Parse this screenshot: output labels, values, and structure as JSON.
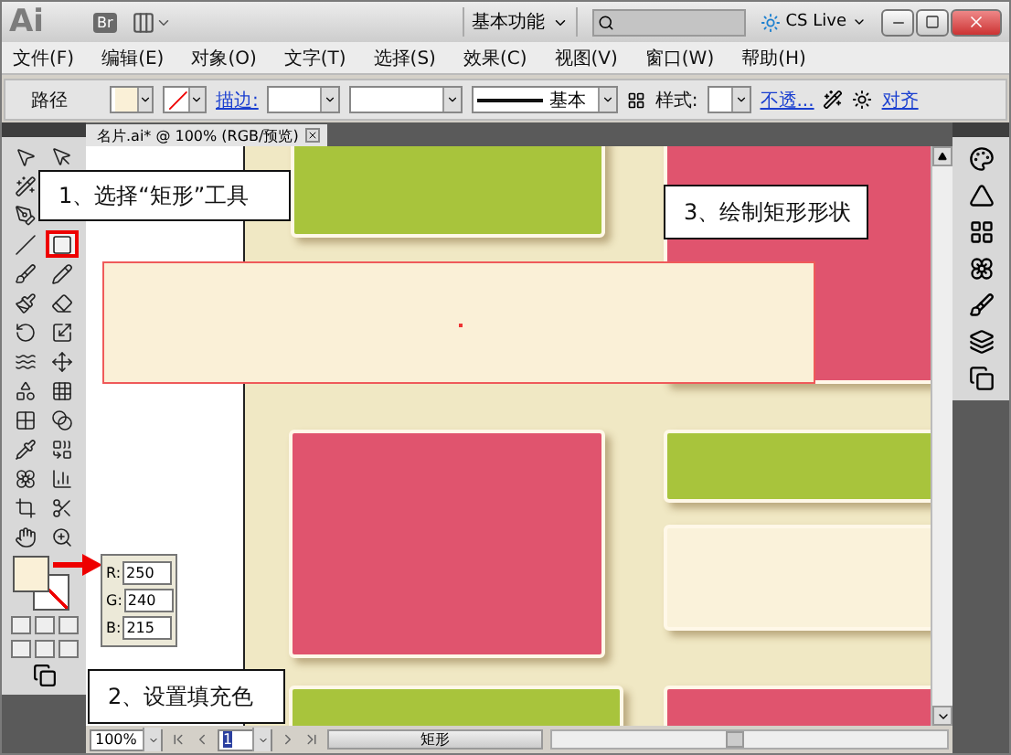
{
  "title_bar": {
    "app_logo": "Ai",
    "bridge": "Br",
    "workspace": "基本功能",
    "cs_live": "CS Live"
  },
  "menu": [
    "文件(F)",
    "编辑(E)",
    "对象(O)",
    "文字(T)",
    "选择(S)",
    "效果(C)",
    "视图(V)",
    "窗口(W)",
    "帮助(H)"
  ],
  "control_bar": {
    "object_type": "路径",
    "stroke_link": "描边:",
    "stroke_profile": "基本",
    "style_label": "样式:",
    "opacity_link": "不透...",
    "align_link": "对齐"
  },
  "document_tab": "名片.ai* @ 100% (RGB/预览)",
  "tool_rows": [
    [
      {
        "kind": "select",
        "selected": false
      },
      {
        "kind": "direct",
        "selected": false
      }
    ],
    [
      {
        "kind": "wand",
        "selected": false
      }
    ],
    [
      {
        "kind": "pen",
        "selected": false
      }
    ],
    [
      {
        "kind": "line",
        "selected": false
      },
      {
        "kind": "rectangle",
        "selected": true
      }
    ],
    [
      {
        "kind": "brush",
        "selected": false
      },
      {
        "kind": "pencil",
        "selected": false
      }
    ],
    [
      {
        "kind": "blob",
        "selected": false
      },
      {
        "kind": "eraser",
        "selected": false
      }
    ],
    [
      {
        "kind": "rotate",
        "selected": false
      },
      {
        "kind": "scale",
        "selected": false
      }
    ],
    [
      {
        "kind": "warp",
        "selected": false
      },
      {
        "kind": "transform",
        "selected": false
      }
    ],
    [
      {
        "kind": "shapes",
        "selected": false
      },
      {
        "kind": "perspective",
        "selected": false
      }
    ],
    [
      {
        "kind": "mesh",
        "selected": false
      },
      {
        "kind": "gradient",
        "selected": false
      }
    ],
    [
      {
        "kind": "eyedropper",
        "selected": false
      },
      {
        "kind": "blend",
        "selected": false
      }
    ],
    [
      {
        "kind": "symbol",
        "selected": false
      },
      {
        "kind": "graph",
        "selected": false
      }
    ],
    [
      {
        "kind": "artboard",
        "selected": false
      },
      {
        "kind": "slice",
        "selected": false
      }
    ],
    [
      {
        "kind": "hand",
        "selected": false
      },
      {
        "kind": "zoom",
        "selected": false
      }
    ]
  ],
  "color_values": [
    {
      "label": "R:",
      "value": "250"
    },
    {
      "label": "G:",
      "value": "240"
    },
    {
      "label": "B:",
      "value": "215"
    }
  ],
  "status_bar": {
    "zoom": "100%",
    "artboard": "1",
    "current_tool": "矩形"
  },
  "callouts": [
    "1、选择“矩形”工具",
    "2、设置填充色",
    "3、绘制矩形形状"
  ]
}
